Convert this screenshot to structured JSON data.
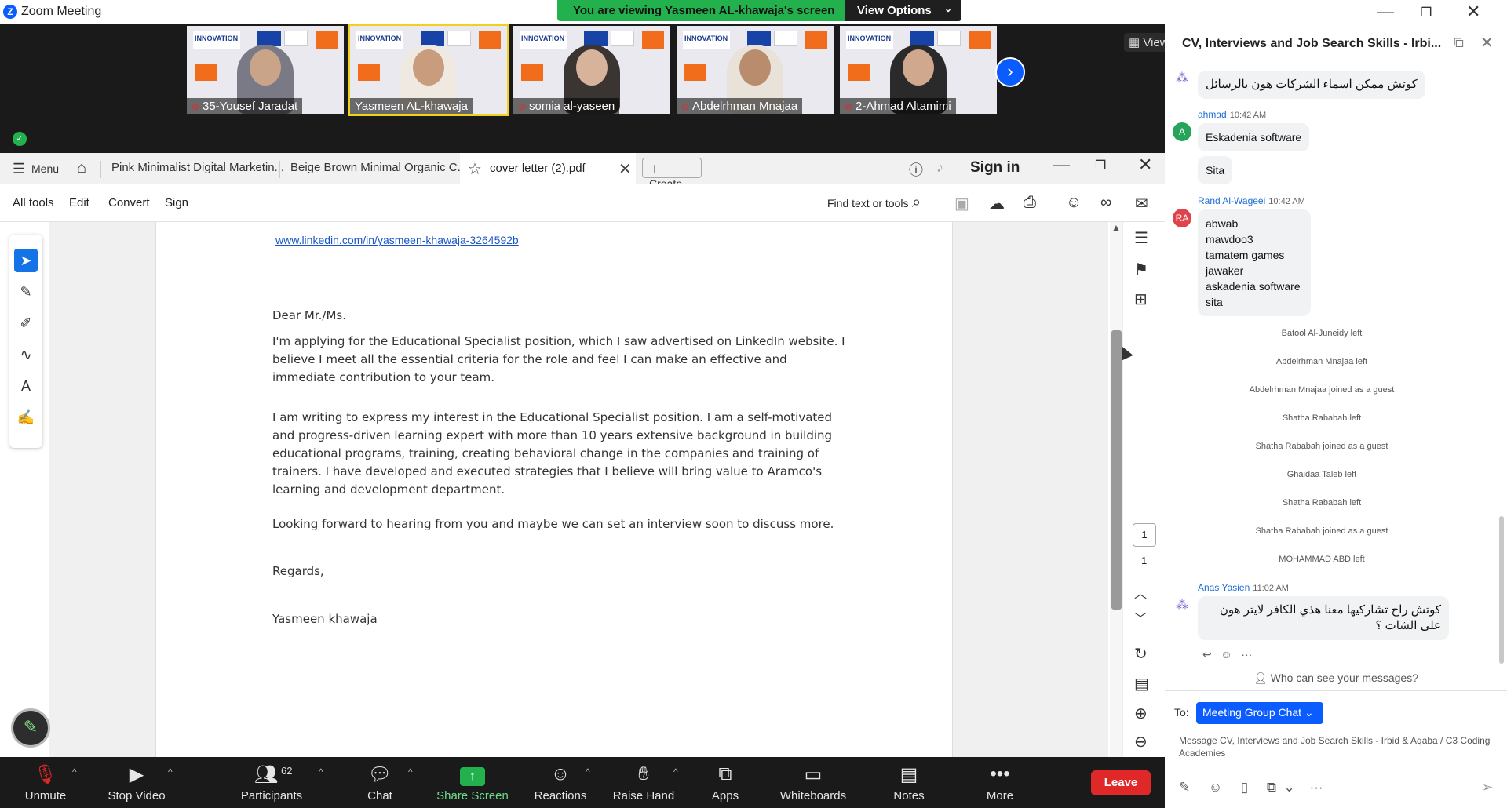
{
  "window": {
    "title": "Zoom Meeting",
    "viewing_banner": "You are viewing Yasmeen AL-khawaja's screen",
    "view_options": "View Options",
    "view_button": "View"
  },
  "participants_tiles": [
    {
      "name": "35-Yousef Jaradat"
    },
    {
      "name": "Yasmeen AL-khawaja"
    },
    {
      "name": "somia al-yaseen"
    },
    {
      "name": "Abdelrhman Mnajaa"
    },
    {
      "name": "2-Ahmad Altamimi"
    }
  ],
  "acrobat": {
    "menu_label": "Menu",
    "tabs": [
      "Pink Minimalist Digital Marketin...",
      "Beige Brown Minimal Organic C..."
    ],
    "active_tab": "cover letter (2).pdf",
    "create": "Create",
    "sign_in": "Sign in",
    "toolbar": [
      "All tools",
      "Edit",
      "Convert",
      "Sign"
    ],
    "find": "Find text or tools",
    "page_current": "1",
    "page_total": "1"
  },
  "document": {
    "linkedin": "www.linkedin.com/in/yasmeen-khawaja-3264592b",
    "greeting": "Dear Mr./Ms.",
    "para1": "I'm applying for the Educational Specialist position, which I saw advertised on LinkedIn website. I believe I meet all the essential criteria for the role and feel I can make an effective and immediate contribution to your team.",
    "para2": "I am writing to express my interest in the Educational Specialist position. I am a self-motivated and progress-driven learning expert with more than 10 years extensive background in building educational programs, training, creating behavioral change in the companies and training of trainers. I have developed and executed strategies that I believe will bring value to Aramco's learning and development department.",
    "para3": "Looking forward to hearing from you and maybe we can set an interview soon to discuss more.",
    "closing": "Regards,",
    "signature": "Yasmeen khawaja"
  },
  "zoom_toolbar": {
    "unmute": "Unmute",
    "stop_video": "Stop Video",
    "participants": "Participants",
    "participants_count": "62",
    "chat": "Chat",
    "share_screen": "Share Screen",
    "reactions": "Reactions",
    "raise_hand": "Raise Hand",
    "apps": "Apps",
    "whiteboards": "Whiteboards",
    "notes": "Notes",
    "more": "More",
    "leave": "Leave"
  },
  "chat": {
    "title": "CV, Interviews and Job Search Skills - Irbi...",
    "msg1": "كوتش ممكن اسماء الشركات هون بالرسائل",
    "ahmad_name": "ahmad",
    "ahmad_time": "10:42 AM",
    "ahmad_msg1": "Eskadenia software",
    "ahmad_msg2": "Sita",
    "rand_name": "Rand Al-Wageei",
    "rand_time": "10:42 AM",
    "rand_initials": "RA",
    "ahmad_initial": "A",
    "rand_lines": [
      "abwab",
      "mawdoo3",
      "tamatem games",
      "jawaker",
      "askadenia software",
      "sita"
    ],
    "system_messages": [
      "Batool Al-Juneidy left",
      "Abdelrhman Mnajaa left",
      "Abdelrhman Mnajaa joined as a guest",
      "Shatha Rababah left",
      "Shatha Rababah joined as a guest",
      "Ghaidaa Taleb left",
      "Shatha Rababah left",
      "Shatha Rababah joined as a guest",
      "MOHAMMAD ABD left"
    ],
    "anas_name": "Anas Yasien",
    "anas_time": "11:02 AM",
    "anas_msg": "كوتش راح تشاركيها معنا هذي الكافر لايتر هون على الشات ؟",
    "who_can_see": "Who can see your messages?",
    "to_label": "To:",
    "to_target": "Meeting Group Chat",
    "input_placeholder": "Message CV, Interviews and Job Search Skills - Irbid & Aqaba / C3 Coding Academies"
  },
  "colors": {
    "zoom_blue": "#0b5cff",
    "share_green": "#23b14d",
    "leave_red": "#e02828",
    "acrobat_select": "#1473e6"
  }
}
